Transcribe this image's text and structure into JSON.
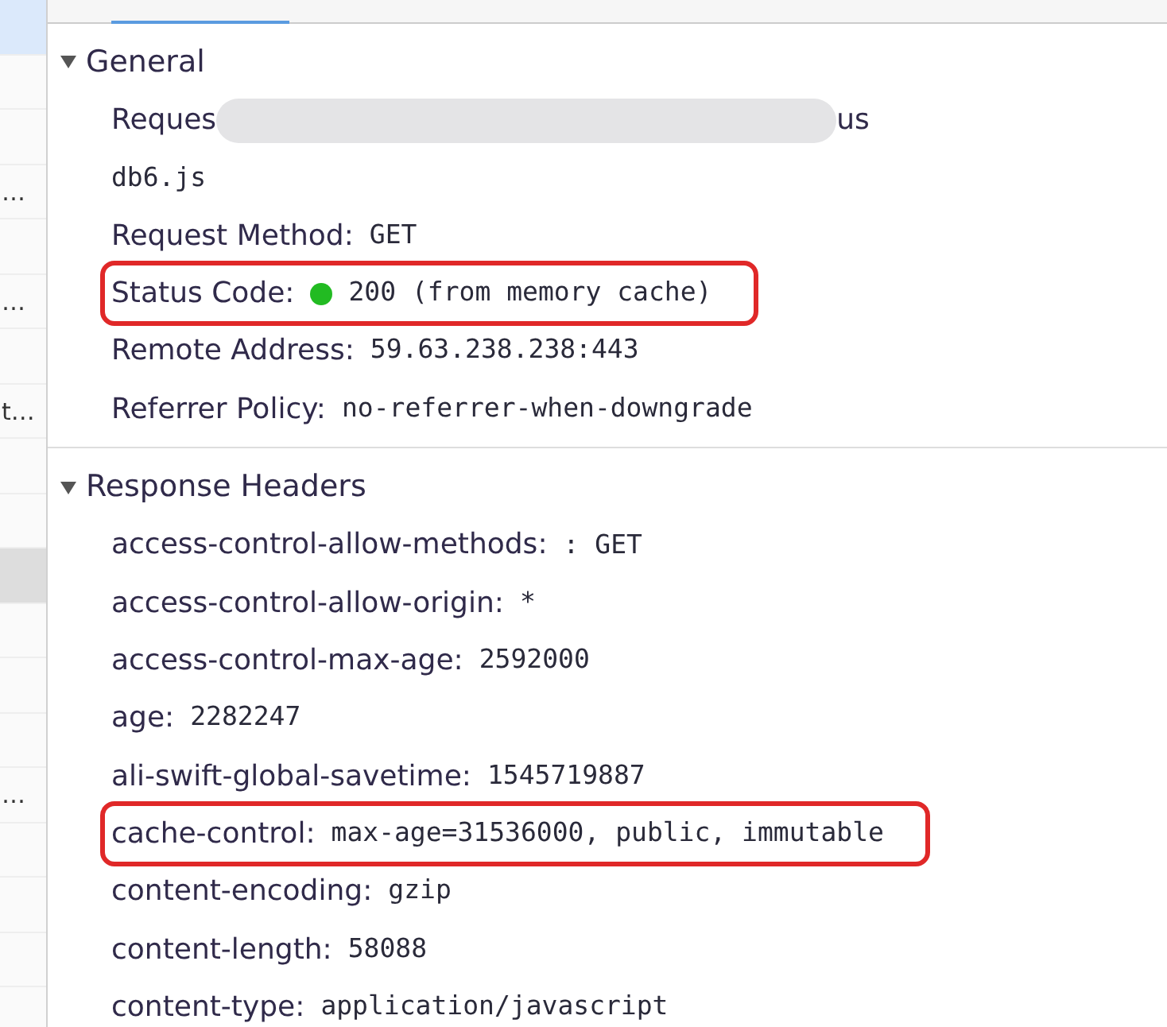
{
  "sidebar": {
    "items": [
      {
        "selected": true
      },
      {
        "selected": false
      },
      {
        "selected": false
      },
      {
        "text": "…",
        "selected": false
      },
      {
        "selected": false
      },
      {
        "text": "…",
        "selected": false
      },
      {
        "selected": false
      },
      {
        "text": "t…",
        "selected": false
      },
      {
        "selected": false
      },
      {
        "selected": false
      },
      {
        "selected": true
      },
      {
        "selected": false
      },
      {
        "selected": false
      },
      {
        "selected": false
      },
      {
        "text": "…",
        "selected": false
      },
      {
        "selected": false
      },
      {
        "selected": false
      },
      {
        "selected": false
      }
    ]
  },
  "sections": [
    {
      "title": "General",
      "expanded": true,
      "rows": [
        {
          "kind": "redacted",
          "key": "Reques",
          "value": "us"
        },
        {
          "kind": "plain",
          "key": "",
          "value": "db6.js"
        },
        {
          "kind": "pair",
          "key": "Request Method:",
          "value": "GET",
          "highlighted": false
        },
        {
          "kind": "status",
          "key": "Status Code:",
          "value": "200  (from memory cache)",
          "color": "#22bb22",
          "highlighted": true
        },
        {
          "kind": "pair",
          "key": "Remote Address:",
          "value": "59.63.238.238:443",
          "highlighted": false
        },
        {
          "kind": "pair",
          "key": "Referrer Policy:",
          "value": "no-referrer-when-downgrade",
          "highlighted": false
        }
      ]
    },
    {
      "title": "Response Headers",
      "expanded": true,
      "rows": [
        {
          "kind": "pair",
          "key": "access-control-allow-methods:",
          "value": ": GET",
          "highlighted": false
        },
        {
          "kind": "pair",
          "key": "access-control-allow-origin:",
          "value": "*",
          "highlighted": false
        },
        {
          "kind": "pair",
          "key": "access-control-max-age:",
          "value": "2592000",
          "highlighted": false
        },
        {
          "kind": "pair",
          "key": "age:",
          "value": "2282247",
          "highlighted": false
        },
        {
          "kind": "pair",
          "key": "ali-swift-global-savetime:",
          "value": "1545719887",
          "highlighted": false
        },
        {
          "kind": "pair",
          "key": "cache-control:",
          "value": "max-age=31536000, public, immutable",
          "highlighted": true
        },
        {
          "kind": "pair",
          "key": "content-encoding:",
          "value": "gzip",
          "highlighted": false
        },
        {
          "kind": "pair",
          "key": "content-length:",
          "value": "58088",
          "highlighted": false
        },
        {
          "kind": "pair",
          "key": "content-type:",
          "value": "application/javascript",
          "highlighted": false
        }
      ]
    }
  ]
}
